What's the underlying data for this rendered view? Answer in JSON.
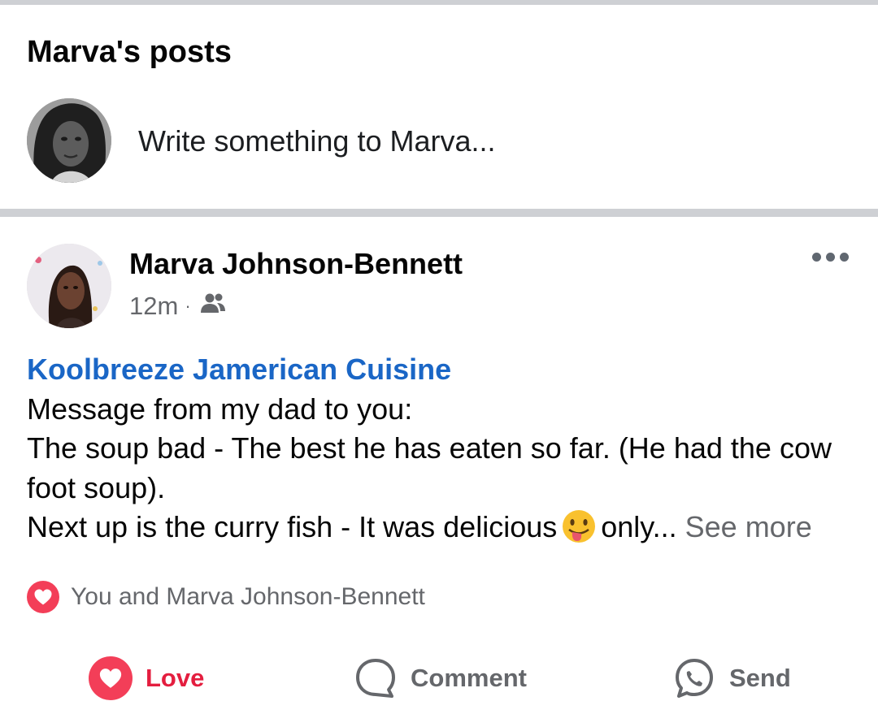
{
  "section": {
    "title": "Marva's posts"
  },
  "composer": {
    "placeholder": "Write something to Marva..."
  },
  "post": {
    "author": "Marva Johnson-Bennett",
    "time": "12m",
    "audience_icon": "friends-icon",
    "tag": "Koolbreeze Jamerican Cuisine",
    "lines": [
      "Message from my dad to you:",
      "The soup bad - The best he has eaten so far. (He had the cow foot soup).",
      "Next up is the curry fish - It was delicious"
    ],
    "after_emoji": "only...",
    "emoji_icon": "face-savoring-food-emoji",
    "see_more": "See more",
    "reaction_summary": "You and Marva Johnson-Bennett",
    "more_icon": "more-horizontal-icon"
  },
  "actions": {
    "love": "Love",
    "comment": "Comment",
    "send": "Send"
  },
  "colors": {
    "accent_link": "#1a66c6",
    "love_red": "#f33e58",
    "love_text": "#e41e3f",
    "muted_text": "#65676b",
    "divider": "#ced0d4"
  }
}
